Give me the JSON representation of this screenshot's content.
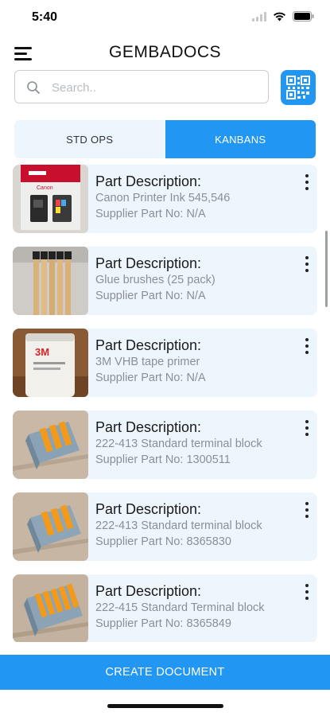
{
  "status_bar": {
    "time": "5:40",
    "icons": [
      "signal-icon",
      "wifi-icon",
      "battery-icon"
    ]
  },
  "header": {
    "title": "GEMBADOCS",
    "menu_icon": "hamburger-menu-icon"
  },
  "search": {
    "placeholder": "Search..",
    "value": "",
    "qr_icon": "qr-code-icon"
  },
  "tabs": [
    {
      "label": "STD OPS",
      "active": false
    },
    {
      "label": "KANBANS",
      "active": true
    }
  ],
  "items": [
    {
      "heading": "Part Description:",
      "description": "Canon Printer Ink 545,546",
      "supplier": "Supplier Part No: N/A",
      "thumb": "printer-ink-photo"
    },
    {
      "heading": "Part Description:",
      "description": "Glue brushes (25 pack)",
      "supplier": "Supplier Part No: N/A",
      "thumb": "glue-brushes-photo"
    },
    {
      "heading": "Part Description:",
      "description": "3M VHB tape primer",
      "supplier": "Supplier Part No: N/A",
      "thumb": "tape-primer-photo"
    },
    {
      "heading": "Part Description:",
      "description": "222-413 Standard terminal block",
      "supplier": "Supplier Part No: 1300511",
      "thumb": "terminal-block-photo"
    },
    {
      "heading": "Part Description:",
      "description": "222-413 Standard terminal block",
      "supplier": "Supplier Part No: 8365830",
      "thumb": "terminal-block-photo"
    },
    {
      "heading": "Part Description:",
      "description": "222-415 Standard Terminal block",
      "supplier": "Supplier Part No: 8365849",
      "thumb": "terminal-block-photo"
    }
  ],
  "create_button": {
    "label": "CREATE DOCUMENT"
  },
  "colors": {
    "accent": "#2196f3",
    "card_background": "#eef6fd",
    "secondary_text": "#8a8f96"
  }
}
